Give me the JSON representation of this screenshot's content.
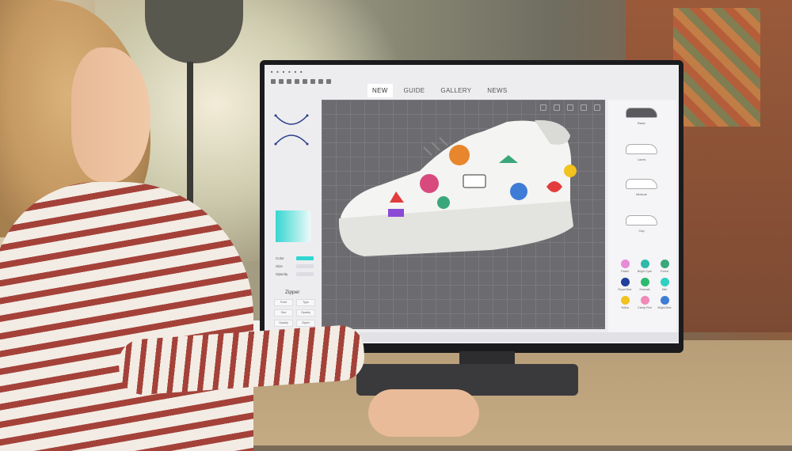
{
  "app": {
    "tabs": [
      "NEW",
      "GUIDE",
      "GALLERY",
      "NEWS"
    ],
    "active_tab": "NEW"
  },
  "left_panel": {
    "properties": [
      {
        "label": "Color",
        "field": "cyan"
      },
      {
        "label": "Size",
        "field": "grey"
      },
      {
        "label": "Opacity",
        "field": "grey"
      }
    ],
    "section_title": "Zipper",
    "zipper_buttons": [
      "Point",
      "Type",
      "Size",
      "Opacity",
      "Opacity",
      "Zipper"
    ]
  },
  "right_panel": {
    "shoe_options": [
      "Basic",
      "Laces",
      "Midsole",
      "Cap"
    ],
    "colors": [
      {
        "name": "Pastel",
        "hex": "#e88ad8"
      },
      {
        "name": "Bright Cyan",
        "hex": "#2fb9a8"
      },
      {
        "name": "Forest",
        "hex": "#3aa77a"
      },
      {
        "name": "Royal Blue",
        "hex": "#1f3f9a"
      },
      {
        "name": "Emerald",
        "hex": "#2dbb6e"
      },
      {
        "name": "Mint",
        "hex": "#2fd0c0"
      },
      {
        "name": "Yellow",
        "hex": "#f2c21e"
      },
      {
        "name": "Candy Pink",
        "hex": "#f08ab8"
      },
      {
        "name": "Bright Blue",
        "hex": "#3f7cd6"
      }
    ]
  },
  "colors": {
    "canvas_bg": "#6c6c70",
    "accent": "#2fd6d2",
    "monitor_bezel": "#1b1b1d"
  }
}
